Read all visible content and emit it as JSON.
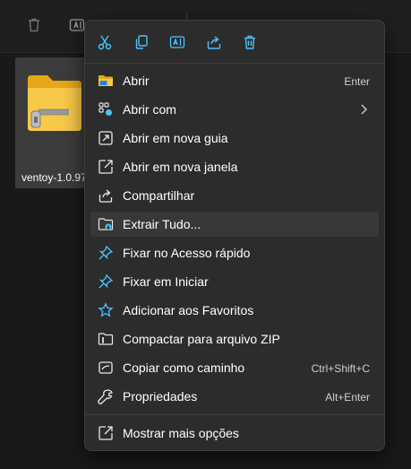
{
  "file": {
    "name": "ventoy-1.0.97"
  },
  "toolbar": {
    "icons": [
      "trash-icon",
      "rename-icon",
      "sort-icon"
    ]
  },
  "quick_actions": [
    {
      "name": "cut-button",
      "icon": "scissors-icon"
    },
    {
      "name": "copy-button",
      "icon": "copy-icon"
    },
    {
      "name": "rename-button",
      "icon": "rename-icon"
    },
    {
      "name": "share-button",
      "icon": "share-icon"
    },
    {
      "name": "delete-button",
      "icon": "trash-icon"
    }
  ],
  "menu": {
    "items": [
      {
        "label": "Abrir",
        "shortcut": "Enter",
        "icon": "folder-open-icon"
      },
      {
        "label": "Abrir com",
        "shortcut": "",
        "icon": "open-with-icon",
        "submenu": true
      },
      {
        "label": "Abrir em nova guia",
        "shortcut": "",
        "icon": "new-tab-icon"
      },
      {
        "label": "Abrir em nova janela",
        "shortcut": "",
        "icon": "new-window-icon"
      },
      {
        "label": "Compartilhar",
        "shortcut": "",
        "icon": "share-icon"
      },
      {
        "label": "Extrair Tudo...",
        "shortcut": "",
        "icon": "extract-icon",
        "highlighted": true
      },
      {
        "label": "Fixar no Acesso rápido",
        "shortcut": "",
        "icon": "pin-icon"
      },
      {
        "label": "Fixar em Iniciar",
        "shortcut": "",
        "icon": "pin-icon"
      },
      {
        "label": "Adicionar aos Favoritos",
        "shortcut": "",
        "icon": "star-icon"
      },
      {
        "label": "Compactar para arquivo ZIP",
        "shortcut": "",
        "icon": "zip-icon"
      },
      {
        "label": "Copiar como caminho",
        "shortcut": "Ctrl+Shift+C",
        "icon": "copy-path-icon"
      },
      {
        "label": "Propriedades",
        "shortcut": "Alt+Enter",
        "icon": "wrench-icon"
      }
    ],
    "more_options": {
      "label": "Mostrar mais opções",
      "shortcut": "",
      "icon": "more-options-icon"
    }
  },
  "colors": {
    "accent": "#4cc2ff",
    "menu_bg": "#2c2c2c",
    "folder": "#f2c94c"
  }
}
